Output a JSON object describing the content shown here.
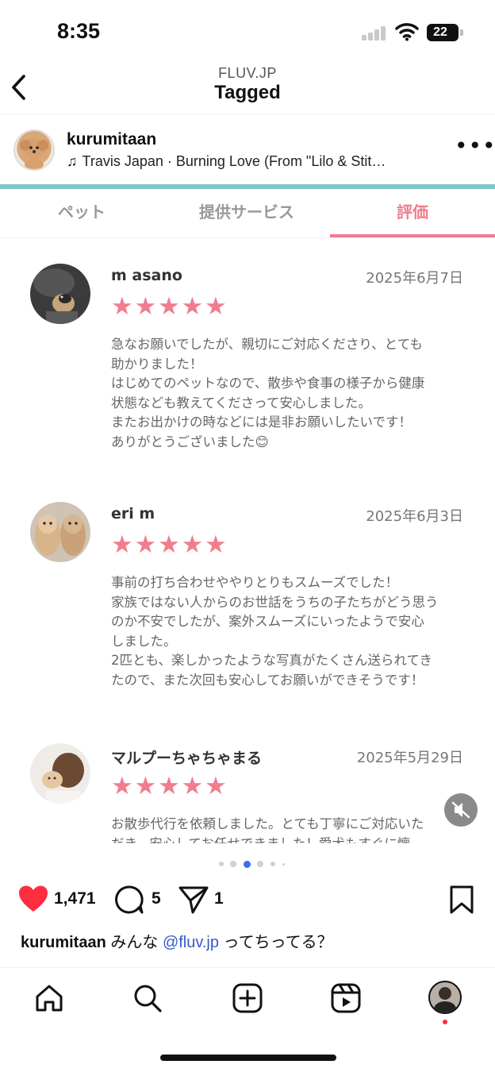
{
  "status_bar": {
    "time": "8:35",
    "battery": "22"
  },
  "header": {
    "subtitle": "FLUV.JP",
    "title": "Tagged"
  },
  "post": {
    "username": "kurumitaan",
    "music": "Travis Japan · Burning Love (From \"Lilo & Stit…",
    "more_icon": "more-horizontal-icon"
  },
  "tabs": [
    {
      "label": "ペット"
    },
    {
      "label": "提供サービス"
    },
    {
      "label": "評価",
      "active": true
    }
  ],
  "reviews": [
    {
      "name": "m asano",
      "date": "2025年6月7日",
      "stars": "★★★★★",
      "text": "急なお願いでしたが、親切にご対応くださり、とても助かりました！\nはじめてのペットなので、散歩や食事の様子から健康状態なども教えてくださって安心しました。\nまたお出かけの時などには是非お願いしたいです！\nありがとうございました😊"
    },
    {
      "name": "eri m",
      "date": "2025年6月3日",
      "stars": "★★★★★",
      "text": "事前の打ち合わせややりとりもスムーズでした！\n家族ではない人からのお世話をうちの子たちがどう思うのか不安でしたが、案外スムーズにいったようで安心しました。\n2匹とも、楽しかったような写真がたくさん送られてきたので、また次回も安心してお願いができそうです！"
    },
    {
      "name": "マルプーちゃちゃまる",
      "date": "2025年5月29日",
      "stars": "★★★★★",
      "text": "お散歩代行を依頼しました。とても丁寧にご対応いただき、安心してお任せできました！愛犬もすぐに懐"
    }
  ],
  "carousel": {
    "total": 6,
    "active_index": 2
  },
  "actions": {
    "likes": "1,471",
    "comments": "5",
    "shares": "1"
  },
  "caption": {
    "user": "kurumitaan",
    "text_before": " みんな ",
    "mention": "@fluv.jp",
    "text_after": " ってちってる？"
  },
  "colors": {
    "accent_pink": "#f07d8d",
    "teal": "#7ec7c9",
    "like_red": "#ff2d3f",
    "mention_blue": "#3858c8"
  }
}
